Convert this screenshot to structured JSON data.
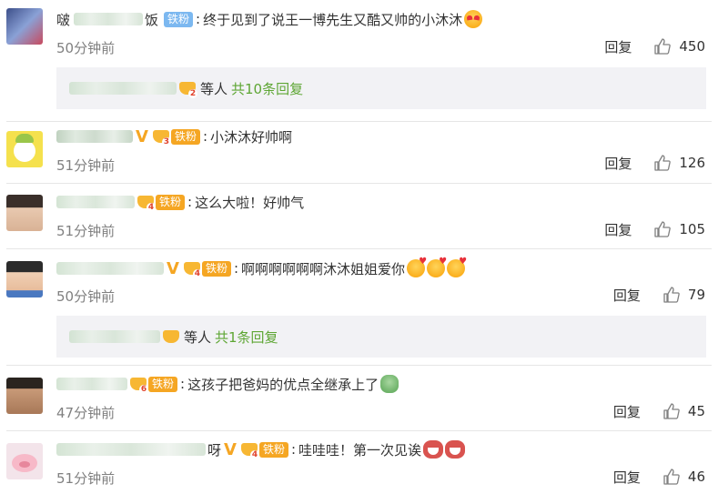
{
  "comments": [
    {
      "name_tail": "饭",
      "badge": "铁粉",
      "text": "终于见到了说王一博先生又酷又帅的小沐沐",
      "time": "50分钟前",
      "reply": "回复",
      "likes": "450",
      "avatar_icon": "group-avatar-icon",
      "emoji": "heart-eyes-emoji"
    },
    {
      "name_tail": "",
      "badge": "铁粉",
      "level": "3",
      "text": "小沐沐好帅啊",
      "time": "51分钟前",
      "reply": "回复",
      "likes": "126",
      "avatar_icon": "cartoon-avatar-icon"
    },
    {
      "name_tail": "",
      "badge": "铁粉",
      "level": "4",
      "text": "这么大啦！好帅气",
      "time": "51分钟前",
      "reply": "回复",
      "likes": "105",
      "avatar_icon": "boy-avatar-icon"
    },
    {
      "name_tail": "",
      "badge": "铁粉",
      "level": "4",
      "text": "啊啊啊啊啊啊沐沐姐姐爱你",
      "time": "50分钟前",
      "reply": "回复",
      "likes": "79",
      "avatar_icon": "child-avatar-icon"
    },
    {
      "name_tail": "",
      "badge": "铁粉",
      "level": "6",
      "text": "这孩子把爸妈的优点全继承上了",
      "time": "47分钟前",
      "reply": "回复",
      "likes": "45",
      "avatar_icon": "man-avatar-icon"
    },
    {
      "name_tail": "呀",
      "badge": "铁粉",
      "level": "4",
      "text": "哇哇哇！第一次见诶",
      "time": "51分钟前",
      "reply": "回复",
      "likes": "46",
      "avatar_icon": "pink-cartoon-avatar-icon"
    }
  ],
  "reply_boxes": [
    {
      "level": "2",
      "suffix": "等人",
      "count_text": "共10条回复"
    },
    {
      "level": "",
      "suffix": "等人",
      "count_text": "共1条回复"
    }
  ],
  "colors": {
    "accent_green": "#5ea634",
    "vip_gold": "#f5a623",
    "badge_blue": "#7cb8f0",
    "reply_box_bg": "#f2f2f5"
  }
}
